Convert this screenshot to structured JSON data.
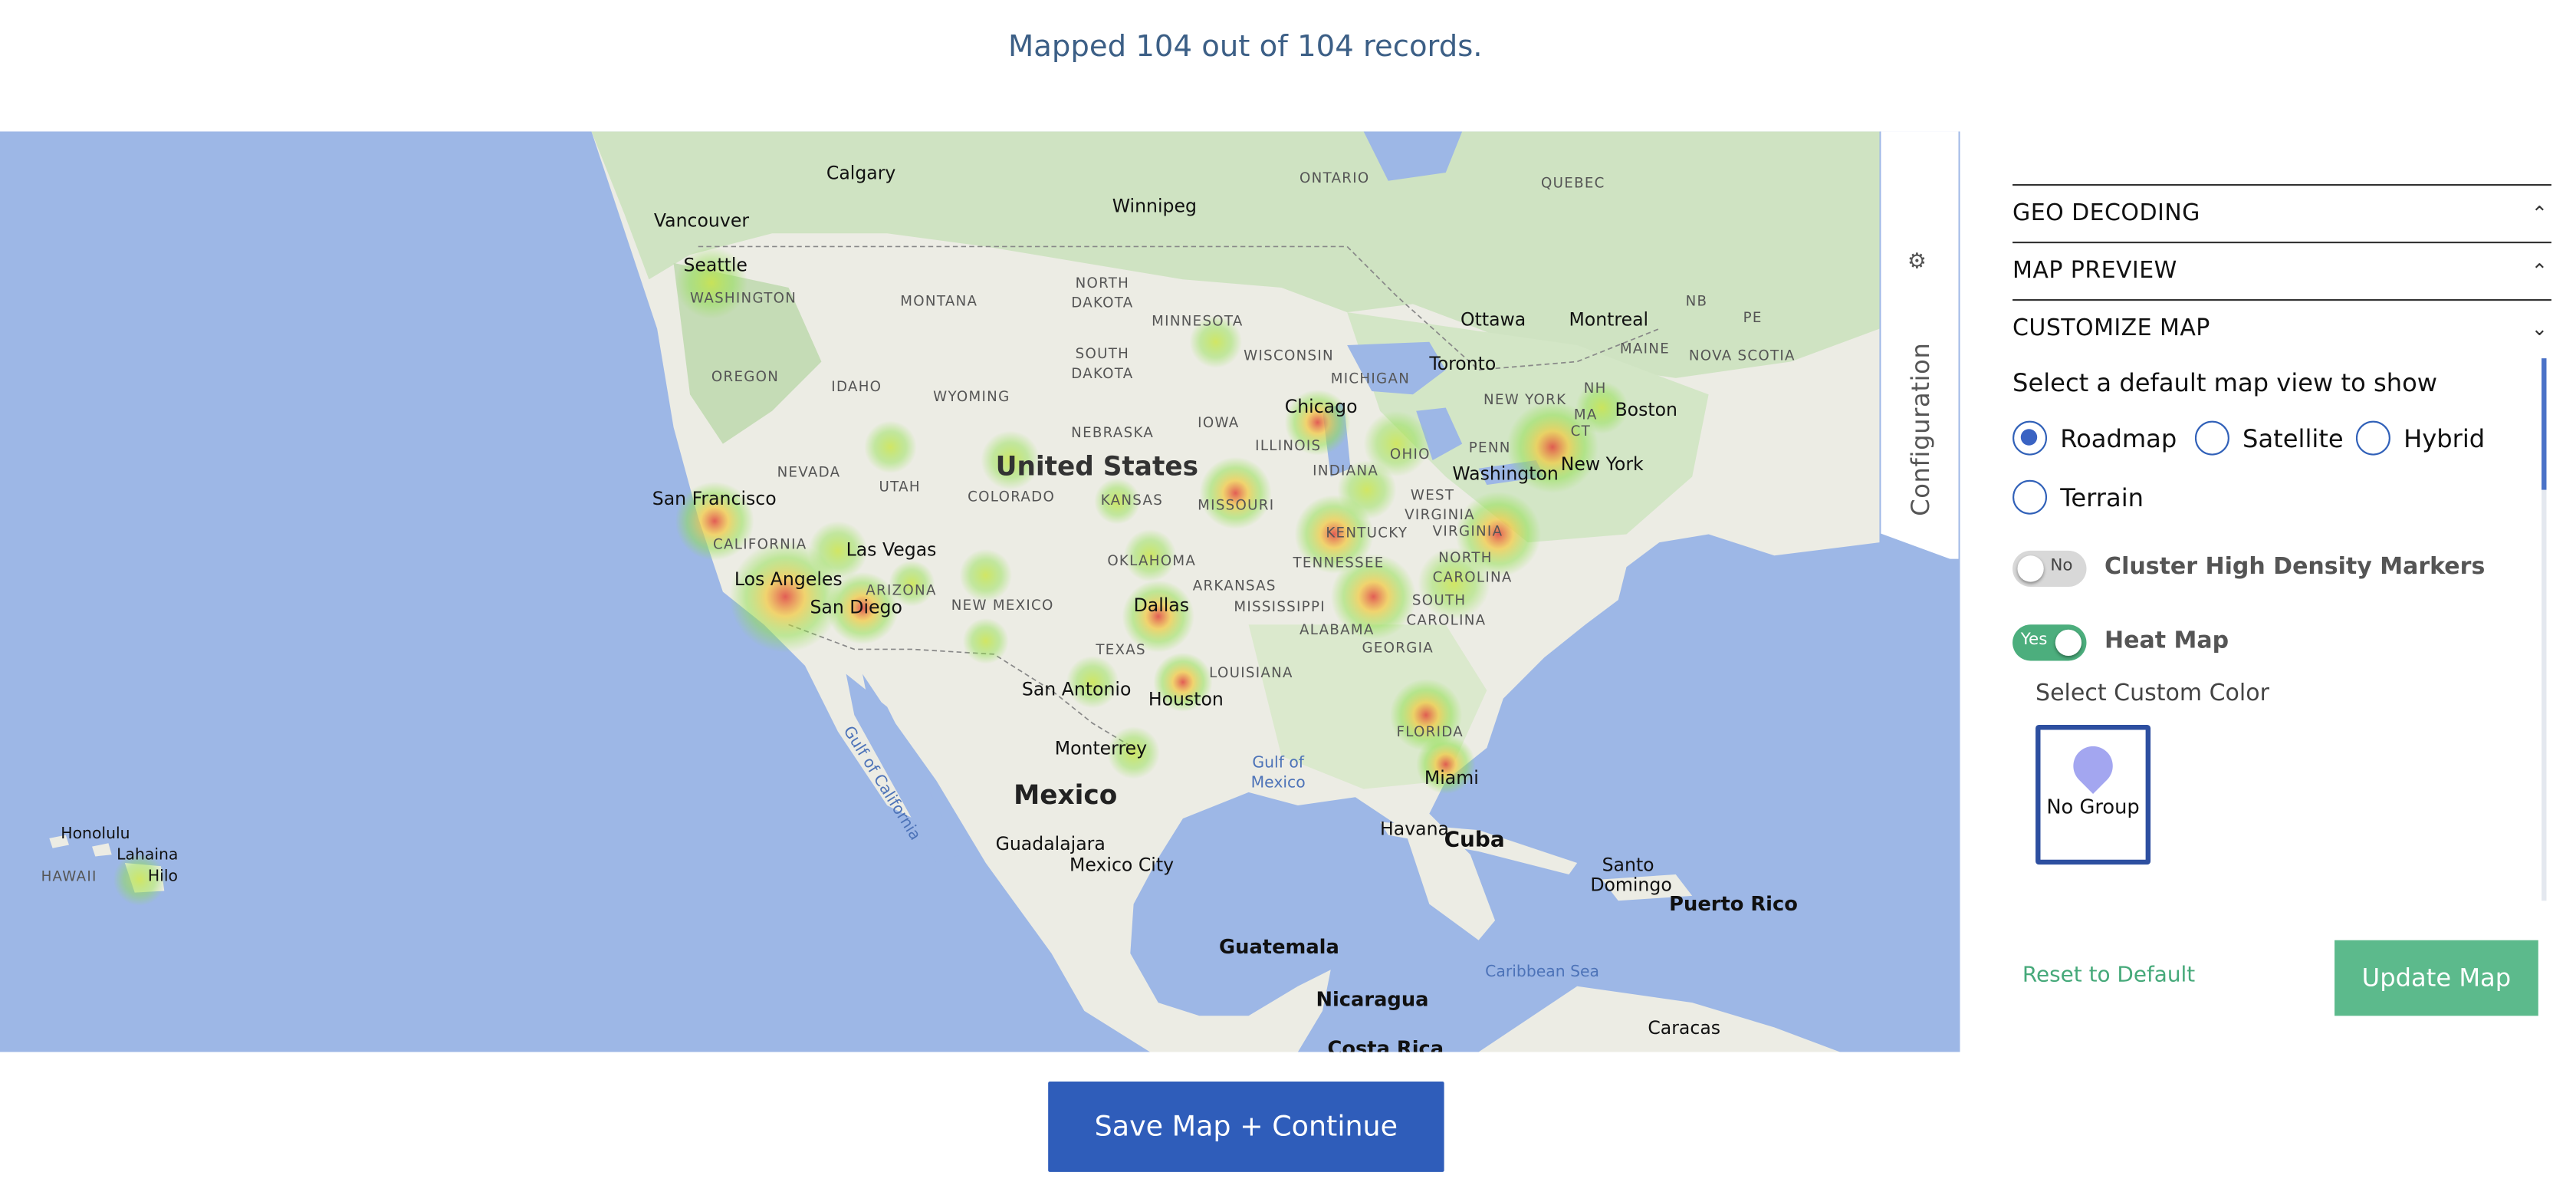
{
  "status": {
    "text": "Mapped 104 out of 104 records."
  },
  "map": {
    "countries": {
      "us": "United States",
      "mx": "Mexico",
      "cuba": "Cuba",
      "guatemala": "Guatemala",
      "nicaragua": "Nicaragua",
      "costa_rica": "Costa Rica"
    },
    "states": {
      "washington": "WASHINGTON",
      "oregon": "OREGON",
      "idaho": "IDAHO",
      "montana": "MONTANA",
      "wyoming": "WYOMING",
      "nevada": "NEVADA",
      "utah": "UTAH",
      "colorado": "COLORADO",
      "california": "CALIFORNIA",
      "arizona": "ARIZONA",
      "new_mexico": "NEW MEXICO",
      "texas": "TEXAS",
      "north_dakota": "NORTH DAKOTA",
      "south_dakota": "SOUTH DAKOTA",
      "nebraska": "NEBRASKA",
      "kansas": "KANSAS",
      "oklahoma": "OKLAHOMA",
      "minnesota": "MINNESOTA",
      "iowa": "IOWA",
      "missouri": "MISSOURI",
      "arkansas": "ARKANSAS",
      "louisiana": "LOUISIANA",
      "wisconsin": "WISCONSIN",
      "illinois": "ILLINOIS",
      "michigan": "MICHIGAN",
      "indiana": "INDIANA",
      "ohio": "OHIO",
      "kentucky": "KENTUCKY",
      "tennessee": "TENNESSEE",
      "mississippi": "MISSISSIPPI",
      "alabama": "ALABAMA",
      "georgia": "GEORGIA",
      "florida": "FLORIDA",
      "south_carolina": "SOUTH CAROLINA",
      "north_carolina": "NORTH CAROLINA",
      "virginia": "VIRGINIA",
      "west_virginia": "WEST VIRGINIA",
      "penn": "PENN",
      "new_york": "NEW YORK",
      "ma": "MA",
      "ct": "CT",
      "nh": "NH",
      "maine": "MAINE",
      "ontario": "ONTARIO",
      "quebec": "QUEBEC",
      "nb": "NB",
      "pe": "PE",
      "nova_scotia": "NOVA SCOTIA",
      "hawaii": "HAWAII"
    },
    "cities": {
      "vancouver": "Vancouver",
      "calgary": "Calgary",
      "winnipeg": "Winnipeg",
      "seattle": "Seattle",
      "san_francisco": "San Francisco",
      "las_vegas": "Las Vegas",
      "los_angeles": "Los Angeles",
      "san_diego": "San Diego",
      "dallas": "Dallas",
      "san_antonio": "San Antonio",
      "houston": "Houston",
      "monterrey": "Monterrey",
      "guadalajara": "Guadalajara",
      "mexico_city": "Mexico City",
      "chicago": "Chicago",
      "toronto": "Toronto",
      "ottawa": "Ottawa",
      "montreal": "Montreal",
      "boston": "Boston",
      "new_york_city": "New York",
      "washington_dc": "Washington",
      "miami": "Miami",
      "havana": "Havana",
      "santo_domingo": "Santo Domingo",
      "puerto_rico": "Puerto Rico",
      "caracas": "Caracas",
      "honolulu": "Honolulu",
      "lahaina": "Lahaina",
      "hilo": "Hilo"
    },
    "water": {
      "gulf_of_mexico": "Gulf of Mexico",
      "gulf_of_california": "Gulf of California",
      "caribbean": "Caribbean Sea"
    },
    "heat_colors": {
      "low": "#8fe04a",
      "mid": "#f2d53c",
      "high": "#e0443c"
    }
  },
  "config_tab": {
    "label": "Configuration",
    "icon": "gear-icon"
  },
  "panel": {
    "sections": [
      {
        "label": "GEO DECODING",
        "chevron": "chevron-up-icon"
      },
      {
        "label": "MAP PREVIEW",
        "chevron": "chevron-up-icon"
      },
      {
        "label": "CUSTOMIZE MAP",
        "chevron": "chevron-down-icon"
      }
    ],
    "view_question": "Select a default map view to show",
    "views": [
      {
        "label": "Roadmap",
        "selected": true
      },
      {
        "label": "Satellite",
        "selected": false
      },
      {
        "label": "Hybrid",
        "selected": false
      },
      {
        "label": "Terrain",
        "selected": false
      }
    ],
    "cluster": {
      "toggle": "No",
      "label": "Cluster High Density Markers",
      "on": false
    },
    "heatmap": {
      "toggle": "Yes",
      "label": "Heat Map",
      "on": true
    },
    "custom_color_label": "Select Custom Color",
    "swatch": {
      "label": "No Group",
      "color": "#a3a6f0"
    },
    "reset_label": "Reset to Default",
    "update_label": "Update Map"
  },
  "save_label": "Save Map + Continue",
  "colors": {
    "accent": "#2f5dba",
    "green": "#5cba8c",
    "water": "#9db7e6",
    "land": "#eeeee8"
  }
}
